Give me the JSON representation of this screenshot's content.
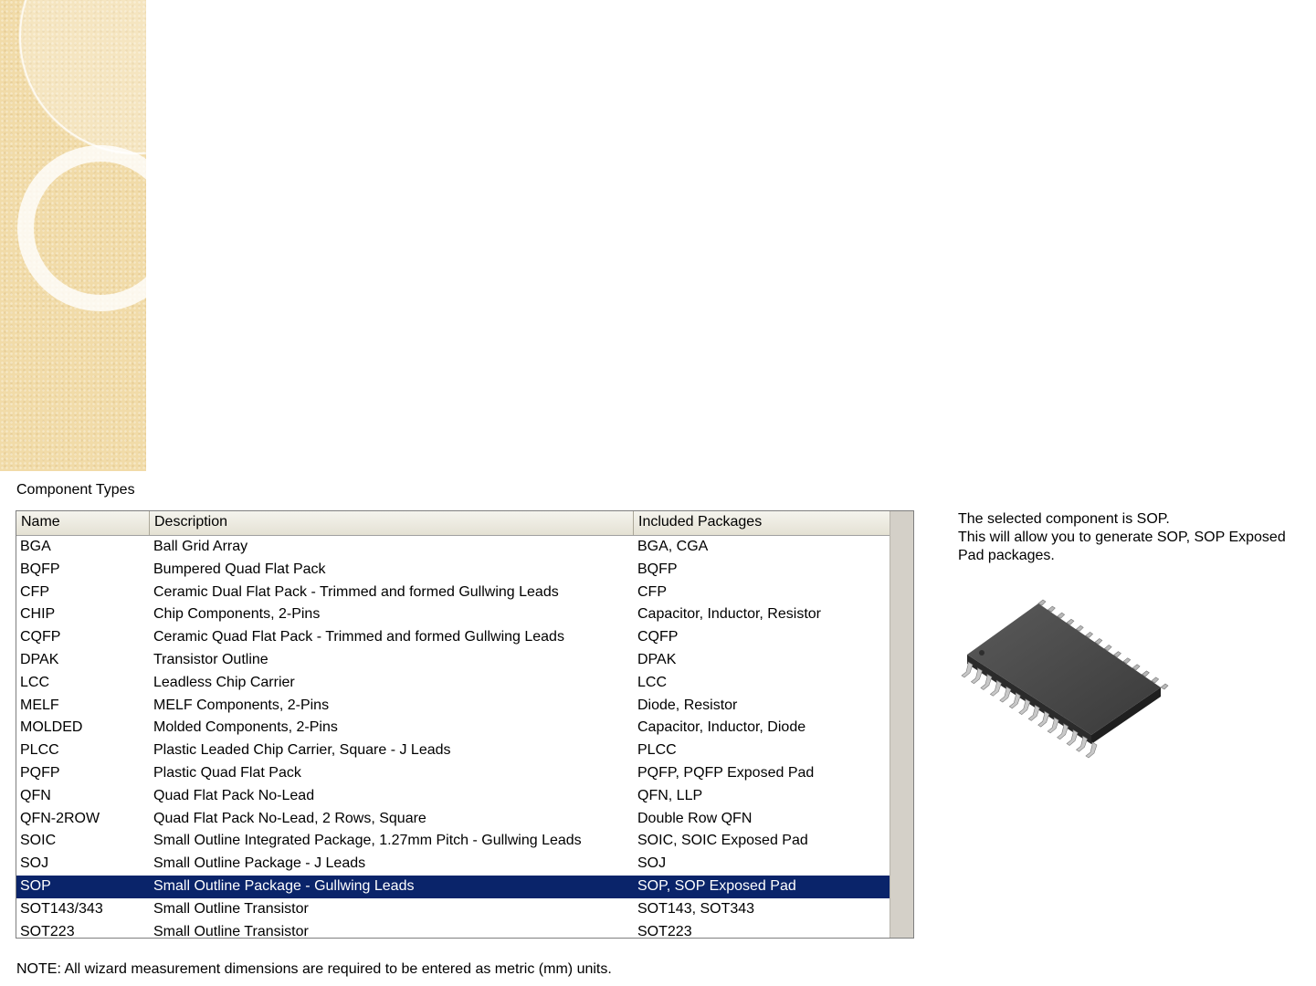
{
  "section_label": "Component Types",
  "table": {
    "columns": [
      "Name",
      "Description",
      "Included Packages"
    ],
    "rows": [
      [
        "BGA",
        "Ball Grid Array",
        "BGA, CGA"
      ],
      [
        "BQFP",
        "Bumpered Quad Flat Pack",
        "BQFP"
      ],
      [
        "CFP",
        "Ceramic Dual Flat Pack - Trimmed and formed Gullwing Leads",
        "CFP"
      ],
      [
        "CHIP",
        "Chip Components, 2-Pins",
        "Capacitor, Inductor, Resistor"
      ],
      [
        "CQFP",
        "Ceramic Quad Flat Pack - Trimmed and formed Gullwing Leads",
        "CQFP"
      ],
      [
        "DPAK",
        "Transistor Outline",
        "DPAK"
      ],
      [
        "LCC",
        "Leadless Chip Carrier",
        "LCC"
      ],
      [
        "MELF",
        "MELF Components, 2-Pins",
        "Diode, Resistor"
      ],
      [
        "MOLDED",
        "Molded Components, 2-Pins",
        "Capacitor, Inductor, Diode"
      ],
      [
        "PLCC",
        "Plastic Leaded Chip Carrier, Square - J Leads",
        "PLCC"
      ],
      [
        "PQFP",
        "Plastic Quad Flat Pack",
        "PQFP, PQFP Exposed Pad"
      ],
      [
        "QFN",
        "Quad Flat Pack No-Lead",
        "QFN, LLP"
      ],
      [
        "QFN-2ROW",
        "Quad Flat Pack No-Lead, 2 Rows, Square",
        "Double Row QFN"
      ],
      [
        "SOIC",
        "Small Outline Integrated Package, 1.27mm Pitch - Gullwing Leads",
        "SOIC, SOIC Exposed Pad"
      ],
      [
        "SOJ",
        "Small Outline Package - J Leads",
        "SOJ"
      ],
      [
        "SOP",
        "Small Outline Package - Gullwing Leads",
        "SOP, SOP Exposed Pad"
      ],
      [
        "SOT143/343",
        "Small Outline Transistor",
        "SOT143, SOT343"
      ],
      [
        "SOT223",
        "Small Outline Transistor",
        "SOT223"
      ]
    ],
    "selected_row": 15
  },
  "info": {
    "line1": "The selected component is SOP.",
    "line2": "This will allow you to generate SOP, SOP Exposed Pad packages."
  },
  "package_image": "sop-chip-image",
  "note": "NOTE: All wizard measurement dimensions are required to be entered as metric (mm) units.",
  "colors": {
    "selection": "#0a246a",
    "deco_background": "#f1dba8"
  }
}
